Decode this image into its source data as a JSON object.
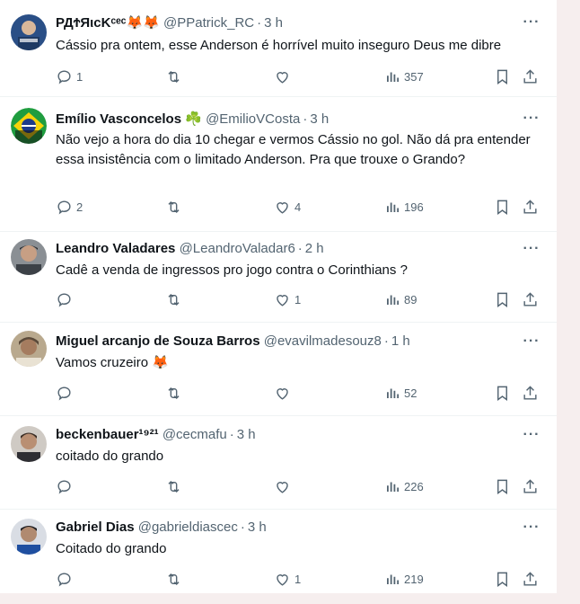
{
  "tweets": [
    {
      "name": "РДϮЯιcKᶜᵉᶜ🦊🦊",
      "handle": "@PPatrick_RC",
      "time": "3 h",
      "text": "Cássio pra ontem, esse Anderson é horrível muito inseguro Deus me dibre",
      "replies": "1",
      "retweets": "",
      "likes": "",
      "views": "357"
    },
    {
      "name": "Emílio Vasconcelos ☘️",
      "handle": "@EmilioVCosta",
      "time": "3 h",
      "text": "Não vejo a hora do dia 10 chegar e vermos Cássio no gol. Não dá pra entender essa insistência com o limitado Anderson. Pra que trouxe o Grando?",
      "replies": "2",
      "retweets": "",
      "likes": "4",
      "views": "196"
    },
    {
      "name": "Leandro Valadares",
      "handle": "@LeandroValadar6",
      "time": "2 h",
      "text": "Cadê a venda de ingressos pro jogo contra o Corinthians ?",
      "replies": "",
      "retweets": "",
      "likes": "1",
      "views": "89"
    },
    {
      "name": "Miguel arcanjo de Souza Barros",
      "handle": "@evavilmadesouz8",
      "time": "1 h",
      "text": "Vamos cruzeiro 🦊",
      "replies": "",
      "retweets": "",
      "likes": "",
      "views": "52"
    },
    {
      "name": "beckenbauer¹⁹²¹",
      "handle": "@cecmafu",
      "time": "3 h",
      "text": "coitado do grando",
      "replies": "",
      "retweets": "",
      "likes": "",
      "views": "226"
    },
    {
      "name": "Gabriel Dias",
      "handle": "@gabrieldiascec",
      "time": "3 h",
      "text": "Coitado do grando",
      "replies": "",
      "retweets": "",
      "likes": "1",
      "views": "219"
    }
  ],
  "dot": "·",
  "more_label": "···",
  "colors": {
    "text": "#0f1419",
    "muted": "#536471",
    "divider": "#eff3f4"
  }
}
